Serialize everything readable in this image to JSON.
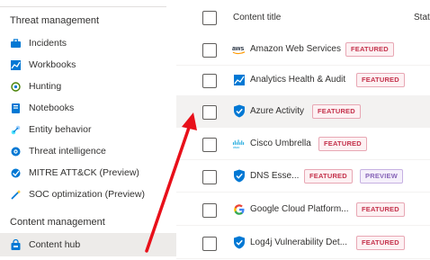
{
  "sidebar": {
    "section_threat": "Threat management",
    "items": [
      {
        "label": "Incidents",
        "icon": "briefcase-icon"
      },
      {
        "label": "Workbooks",
        "icon": "chart-icon"
      },
      {
        "label": "Hunting",
        "icon": "target-icon"
      },
      {
        "label": "Notebooks",
        "icon": "notebook-icon"
      },
      {
        "label": "Entity behavior",
        "icon": "entity-icon"
      },
      {
        "label": "Threat intelligence",
        "icon": "threat-intel-icon"
      },
      {
        "label": "MITRE ATT&CK (Preview)",
        "icon": "mitre-icon"
      },
      {
        "label": "SOC optimization (Preview)",
        "icon": "wand-icon"
      }
    ],
    "section_content": "Content management",
    "content_items": [
      {
        "label": "Content hub",
        "icon": "store-icon"
      }
    ]
  },
  "table": {
    "col_title": "Content title",
    "col_status": "Stat",
    "rows": [
      {
        "name": "Amazon Web Services",
        "logo": "aws-logo",
        "badges": [
          "FEATURED"
        ]
      },
      {
        "name": "Analytics Health & Audit",
        "logo": "analytics-logo",
        "badges": [
          "FEATURED"
        ]
      },
      {
        "name": "Azure Activity",
        "logo": "azure-shield-logo",
        "badges": [
          "FEATURED"
        ]
      },
      {
        "name": "Cisco Umbrella",
        "logo": "cisco-logo",
        "badges": [
          "FEATURED"
        ]
      },
      {
        "name": "DNS Esse...",
        "logo": "azure-shield-logo",
        "badges": [
          "FEATURED",
          "PREVIEW"
        ]
      },
      {
        "name": "Google Cloud Platform...",
        "logo": "google-logo",
        "badges": [
          "FEATURED"
        ]
      },
      {
        "name": "Log4j Vulnerability Det...",
        "logo": "azure-shield-logo",
        "badges": [
          "FEATURED"
        ]
      }
    ]
  },
  "colors": {
    "accent": "#0078d4",
    "featured": "#c4314b",
    "preview": "#8764b8",
    "arrow": "#e8101a"
  }
}
